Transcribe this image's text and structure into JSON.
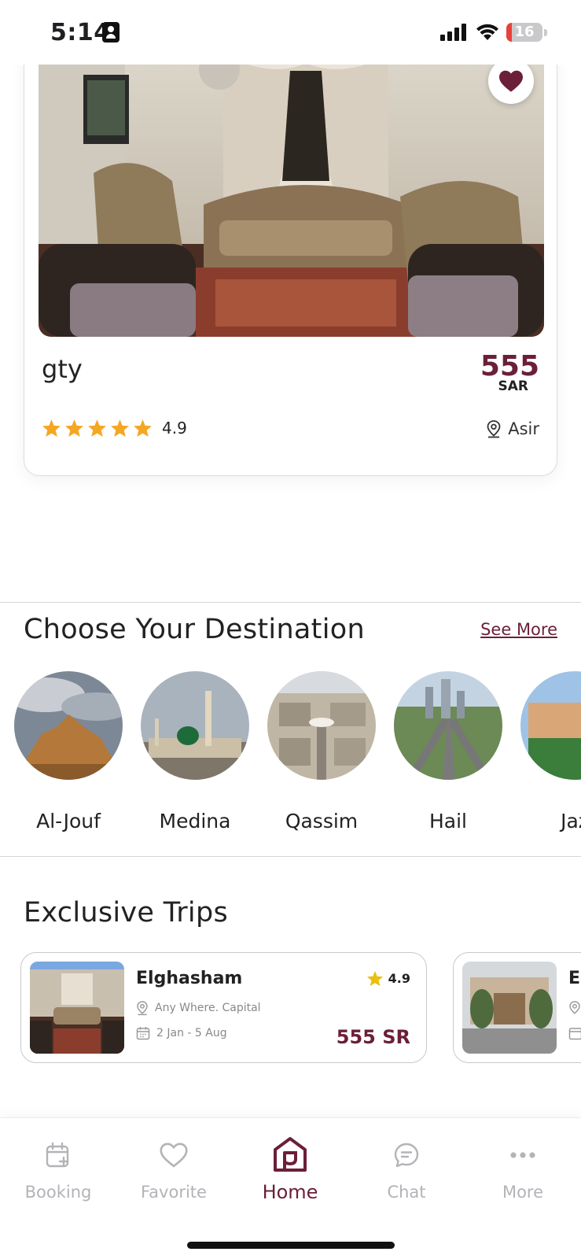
{
  "status_bar": {
    "time": "5:14",
    "battery": "16",
    "battery_fraction": 0.16
  },
  "listing": {
    "title": "gty",
    "price": "555",
    "currency": "SAR",
    "rating": "4.9",
    "stars": 5,
    "location": "Asir",
    "favorited": true,
    "favorite_color": "#6b1f38"
  },
  "destinations": {
    "title": "Choose Your Destination",
    "see_more": "See More",
    "items": [
      {
        "label": "Al-Jouf"
      },
      {
        "label": "Medina"
      },
      {
        "label": "Qassim"
      },
      {
        "label": "Hail"
      },
      {
        "label": "Jaz"
      }
    ]
  },
  "trips": {
    "title": "Exclusive Trips",
    "items": [
      {
        "name": "Elghasham",
        "rating": "4.9",
        "location": "Any Where. Capital",
        "dates": "2 Jan - 5 Aug",
        "price": "555 SR"
      },
      {
        "name": "E"
      }
    ]
  },
  "bottom_nav": {
    "items": [
      {
        "label": "Booking",
        "icon": "calendar-plus-icon",
        "active": false
      },
      {
        "label": "Favorite",
        "icon": "heart-icon",
        "active": false
      },
      {
        "label": "Home",
        "icon": "home-icon",
        "active": true
      },
      {
        "label": "Chat",
        "icon": "chat-icon",
        "active": false
      },
      {
        "label": "More",
        "icon": "more-dots-icon",
        "active": false
      }
    ]
  },
  "colors": {
    "accent": "#6b1f38",
    "star": "#f5a623",
    "inactive": "#b3b3b8"
  }
}
